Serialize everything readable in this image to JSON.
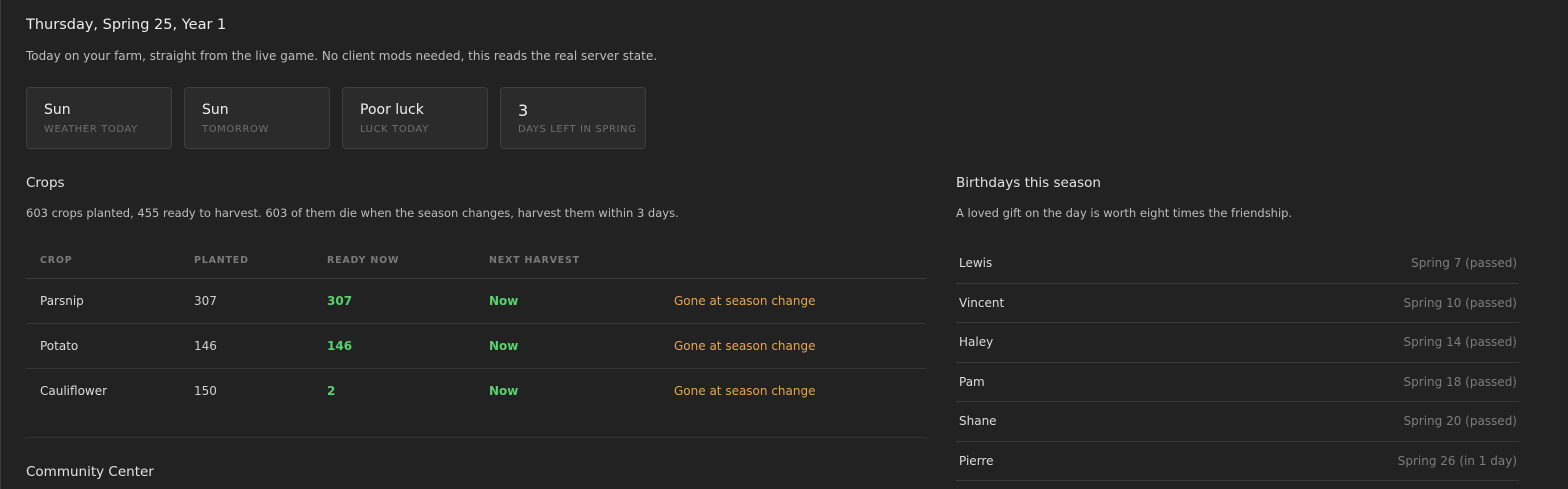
{
  "header": {
    "date": "Thursday, Spring 25, Year 1",
    "subtitle": "Today on your farm, straight from the live game. No client mods needed, this reads the real server state."
  },
  "cards": [
    {
      "value": "Sun",
      "label": "WEATHER TODAY"
    },
    {
      "value": "Sun",
      "label": "TOMORROW"
    },
    {
      "value": "Poor luck",
      "label": "LUCK TODAY"
    },
    {
      "value": "3",
      "label": "DAYS LEFT IN SPRING"
    }
  ],
  "crops": {
    "title": "Crops",
    "description": "603 crops planted, 455 ready to harvest. 603 of them die when the season changes, harvest them within 3 days.",
    "columns": [
      "CROP",
      "PLANTED",
      "READY NOW",
      "NEXT HARVEST"
    ],
    "rows": [
      {
        "crop": "Parsnip",
        "planted": "307",
        "ready": "307",
        "next": "Now",
        "note": "Gone at season change"
      },
      {
        "crop": "Potato",
        "planted": "146",
        "ready": "146",
        "next": "Now",
        "note": "Gone at season change"
      },
      {
        "crop": "Cauliflower",
        "planted": "150",
        "ready": "2",
        "next": "Now",
        "note": "Gone at season change"
      }
    ]
  },
  "community": {
    "title": "Community Center"
  },
  "birthdays": {
    "title": "Birthdays this season",
    "description": "A loved gift on the day is worth eight times the friendship.",
    "items": [
      {
        "name": "Lewis",
        "date": "Spring 7 (passed)"
      },
      {
        "name": "Vincent",
        "date": "Spring 10 (passed)"
      },
      {
        "name": "Haley",
        "date": "Spring 14 (passed)"
      },
      {
        "name": "Pam",
        "date": "Spring 18 (passed)"
      },
      {
        "name": "Shane",
        "date": "Spring 20 (passed)"
      },
      {
        "name": "Pierre",
        "date": "Spring 26 (in 1 day)"
      }
    ]
  },
  "colors": {
    "background": "#222222",
    "ready_green": "#59d16f",
    "warning_orange": "#e7a64c"
  }
}
